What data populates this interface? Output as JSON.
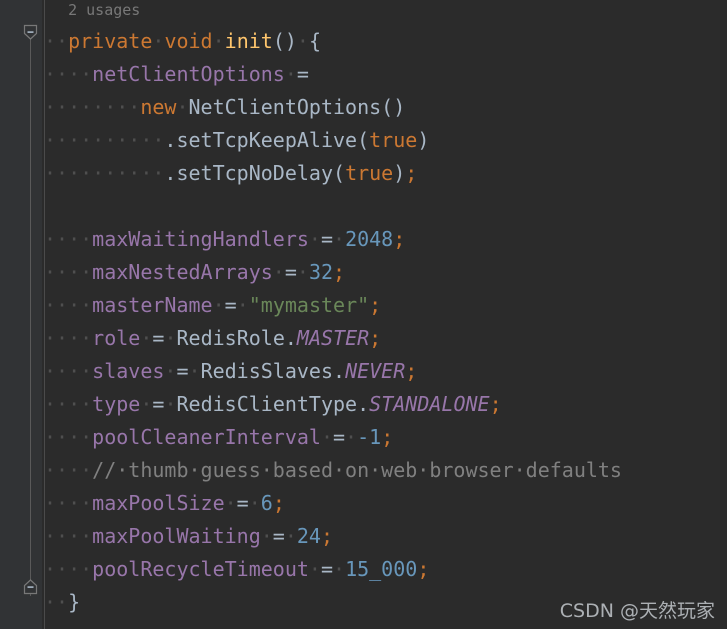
{
  "editor": {
    "theme": "darcula",
    "background": "#2B2B2B",
    "gutter_background": "#313335",
    "colors": {
      "keyword": "#CC7832",
      "method": "#FFC66D",
      "field": "#9876AA",
      "class": "#A9B7C6",
      "number": "#6897BB",
      "string": "#6A8759",
      "comment": "#808080",
      "semicolon": "#CC7832",
      "whitespace_dot": "#4F4F4F",
      "indent_guide": "#4B4B4B",
      "fold_line": "#5A5A5A"
    },
    "language": "java",
    "hint_label": "2 usages",
    "fold_markers": [
      {
        "name": "fold-collapse-method-start",
        "glyph": "minus"
      },
      {
        "name": "fold-collapse-method-end",
        "glyph": "minus"
      }
    ]
  },
  "code_lines": [
    {
      "id": "line-usages",
      "indent_dots": 0,
      "tokens": [
        {
          "text": "  ",
          "cls": "plain"
        },
        {
          "text": "2 usages",
          "cls": "usages"
        }
      ]
    },
    {
      "id": "line-signature",
      "indent_dots": 2,
      "tokens": [
        {
          "text": "private",
          "cls": "kw"
        },
        {
          "text": "·",
          "cls": "ws"
        },
        {
          "text": "void",
          "cls": "kw"
        },
        {
          "text": "·",
          "cls": "ws"
        },
        {
          "text": "init",
          "cls": "method"
        },
        {
          "text": "()",
          "cls": "paren"
        },
        {
          "text": "·",
          "cls": "ws"
        },
        {
          "text": "{",
          "cls": "punc"
        }
      ]
    },
    {
      "id": "line-netclientoptions",
      "indent_dots": 4,
      "tokens": [
        {
          "text": "netClientOptions",
          "cls": "field"
        },
        {
          "text": "·",
          "cls": "ws"
        },
        {
          "text": "=",
          "cls": "op"
        }
      ]
    },
    {
      "id": "line-new-netclientoptions",
      "indent_dots": 8,
      "tokens": [
        {
          "text": "new",
          "cls": "kw"
        },
        {
          "text": "·",
          "cls": "ws"
        },
        {
          "text": "NetClientOptions",
          "cls": "cls"
        },
        {
          "text": "()",
          "cls": "paren"
        }
      ]
    },
    {
      "id": "line-settcpkeepalive",
      "indent_dots": 10,
      "tokens": [
        {
          "text": ".",
          "cls": "punc"
        },
        {
          "text": "setTcpKeepAlive",
          "cls": "cls"
        },
        {
          "text": "(",
          "cls": "paren"
        },
        {
          "text": "true",
          "cls": "kw"
        },
        {
          "text": ")",
          "cls": "paren"
        }
      ]
    },
    {
      "id": "line-settcpnodelay",
      "indent_dots": 10,
      "tokens": [
        {
          "text": ".",
          "cls": "punc"
        },
        {
          "text": "setTcpNoDelay",
          "cls": "cls"
        },
        {
          "text": "(",
          "cls": "paren"
        },
        {
          "text": "true",
          "cls": "kw"
        },
        {
          "text": ")",
          "cls": "paren"
        },
        {
          "text": ";",
          "cls": "semi"
        }
      ]
    },
    {
      "id": "line-blank-1",
      "indent_dots": 0,
      "tokens": []
    },
    {
      "id": "line-maxwaitinghandlers",
      "indent_dots": 4,
      "tokens": [
        {
          "text": "maxWaitingHandlers",
          "cls": "field"
        },
        {
          "text": "·",
          "cls": "ws"
        },
        {
          "text": "=",
          "cls": "op"
        },
        {
          "text": "·",
          "cls": "ws"
        },
        {
          "text": "2048",
          "cls": "num"
        },
        {
          "text": ";",
          "cls": "semi"
        }
      ]
    },
    {
      "id": "line-maxnestedarrays",
      "indent_dots": 4,
      "tokens": [
        {
          "text": "maxNestedArrays",
          "cls": "field"
        },
        {
          "text": "·",
          "cls": "ws"
        },
        {
          "text": "=",
          "cls": "op"
        },
        {
          "text": "·",
          "cls": "ws"
        },
        {
          "text": "32",
          "cls": "num"
        },
        {
          "text": ";",
          "cls": "semi"
        }
      ]
    },
    {
      "id": "line-mastername",
      "indent_dots": 4,
      "tokens": [
        {
          "text": "masterName",
          "cls": "field"
        },
        {
          "text": "·",
          "cls": "ws"
        },
        {
          "text": "=",
          "cls": "op"
        },
        {
          "text": "·",
          "cls": "ws"
        },
        {
          "text": "\"mymaster\"",
          "cls": "str"
        },
        {
          "text": ";",
          "cls": "semi"
        }
      ]
    },
    {
      "id": "line-role",
      "indent_dots": 4,
      "tokens": [
        {
          "text": "role",
          "cls": "field"
        },
        {
          "text": "·",
          "cls": "ws"
        },
        {
          "text": "=",
          "cls": "op"
        },
        {
          "text": "·",
          "cls": "ws"
        },
        {
          "text": "RedisRole",
          "cls": "cls"
        },
        {
          "text": ".",
          "cls": "punc"
        },
        {
          "text": "MASTER",
          "cls": "enumc"
        },
        {
          "text": ";",
          "cls": "semi"
        }
      ]
    },
    {
      "id": "line-slaves",
      "indent_dots": 4,
      "tokens": [
        {
          "text": "slaves",
          "cls": "field"
        },
        {
          "text": "·",
          "cls": "ws"
        },
        {
          "text": "=",
          "cls": "op"
        },
        {
          "text": "·",
          "cls": "ws"
        },
        {
          "text": "RedisSlaves",
          "cls": "cls"
        },
        {
          "text": ".",
          "cls": "punc"
        },
        {
          "text": "NEVER",
          "cls": "enumc"
        },
        {
          "text": ";",
          "cls": "semi"
        }
      ]
    },
    {
      "id": "line-type",
      "indent_dots": 4,
      "tokens": [
        {
          "text": "type",
          "cls": "field"
        },
        {
          "text": "·",
          "cls": "ws"
        },
        {
          "text": "=",
          "cls": "op"
        },
        {
          "text": "·",
          "cls": "ws"
        },
        {
          "text": "RedisClientType",
          "cls": "cls"
        },
        {
          "text": ".",
          "cls": "punc"
        },
        {
          "text": "STANDALONE",
          "cls": "enumc"
        },
        {
          "text": ";",
          "cls": "semi"
        }
      ]
    },
    {
      "id": "line-poolcleanerinterval",
      "indent_dots": 4,
      "tokens": [
        {
          "text": "poolCleanerInterval",
          "cls": "field"
        },
        {
          "text": "·",
          "cls": "ws"
        },
        {
          "text": "=",
          "cls": "op"
        },
        {
          "text": "·",
          "cls": "ws"
        },
        {
          "text": "-1",
          "cls": "num"
        },
        {
          "text": ";",
          "cls": "semi"
        }
      ]
    },
    {
      "id": "line-comment",
      "indent_dots": 4,
      "tokens": [
        {
          "text": "//·thumb·guess·based·on·web·browser·defaults",
          "cls": "comment"
        }
      ]
    },
    {
      "id": "line-maxpoolsize",
      "indent_dots": 4,
      "tokens": [
        {
          "text": "maxPoolSize",
          "cls": "field"
        },
        {
          "text": "·",
          "cls": "ws"
        },
        {
          "text": "=",
          "cls": "op"
        },
        {
          "text": "·",
          "cls": "ws"
        },
        {
          "text": "6",
          "cls": "num"
        },
        {
          "text": ";",
          "cls": "semi"
        }
      ]
    },
    {
      "id": "line-maxpoolwaiting",
      "indent_dots": 4,
      "tokens": [
        {
          "text": "maxPoolWaiting",
          "cls": "field"
        },
        {
          "text": "·",
          "cls": "ws"
        },
        {
          "text": "=",
          "cls": "op"
        },
        {
          "text": "·",
          "cls": "ws"
        },
        {
          "text": "24",
          "cls": "num"
        },
        {
          "text": ";",
          "cls": "semi"
        }
      ]
    },
    {
      "id": "line-poolrecycletimeout",
      "indent_dots": 4,
      "tokens": [
        {
          "text": "poolRecycleTimeout",
          "cls": "field"
        },
        {
          "text": "·",
          "cls": "ws"
        },
        {
          "text": "=",
          "cls": "op"
        },
        {
          "text": "·",
          "cls": "ws"
        },
        {
          "text": "15_000",
          "cls": "num"
        },
        {
          "text": ";",
          "cls": "semi"
        }
      ]
    },
    {
      "id": "line-close-brace",
      "indent_dots": 2,
      "tokens": [
        {
          "text": "}",
          "cls": "punc"
        }
      ]
    }
  ],
  "watermark": {
    "text": "CSDN @天然玩家"
  }
}
